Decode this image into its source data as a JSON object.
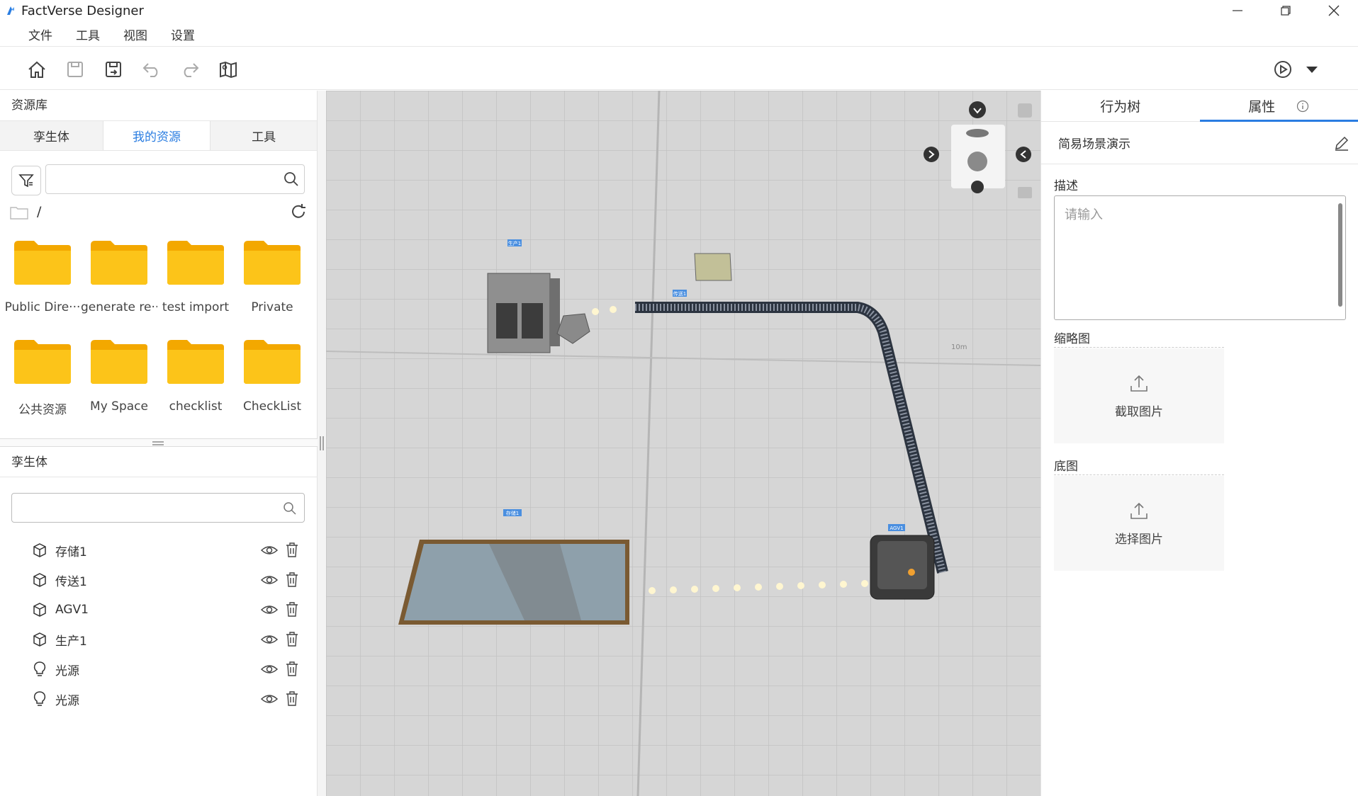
{
  "window": {
    "title": "FactVerse Designer"
  },
  "menu": [
    "文件",
    "工具",
    "视图",
    "设置"
  ],
  "library": {
    "header": "资源库",
    "tabs": [
      "孪生体",
      "我的资源",
      "工具"
    ],
    "active_tab": "我的资源",
    "search": {
      "value": "",
      "placeholder": ""
    },
    "path": "/",
    "folders": [
      "Public Dire···",
      "generate re···",
      "test import",
      "Private",
      "公共资源",
      "My Space",
      "checklist",
      "CheckList"
    ]
  },
  "twins": {
    "header": "孪生体",
    "search": {
      "value": "",
      "placeholder": ""
    },
    "items": [
      {
        "label": "存储1",
        "icon": "cube-icon"
      },
      {
        "label": "传送1",
        "icon": "cube-icon"
      },
      {
        "label": "AGV1",
        "icon": "cube-icon"
      },
      {
        "label": "生产1",
        "icon": "cube-icon"
      },
      {
        "label": "光源",
        "icon": "bulb-icon"
      },
      {
        "label": "光源",
        "icon": "bulb-icon"
      }
    ]
  },
  "viewport": {
    "labels": [
      "生产1",
      "传送1",
      "存储1",
      "AGV1",
      "10m"
    ]
  },
  "right_panel": {
    "tabs": [
      "行为树",
      "属性"
    ],
    "active_tab": "属性",
    "scene_name": "简易场景演示",
    "description_label": "描述",
    "description_placeholder": "请输入",
    "thumbnail_label": "缩略图",
    "thumbnail_button": "截取图片",
    "basemap_label": "底图",
    "basemap_button": "选择图片"
  },
  "colors": {
    "accent": "#2a7de1",
    "folder": "#f7b500",
    "viewport_bg": "#d3d3d3"
  }
}
